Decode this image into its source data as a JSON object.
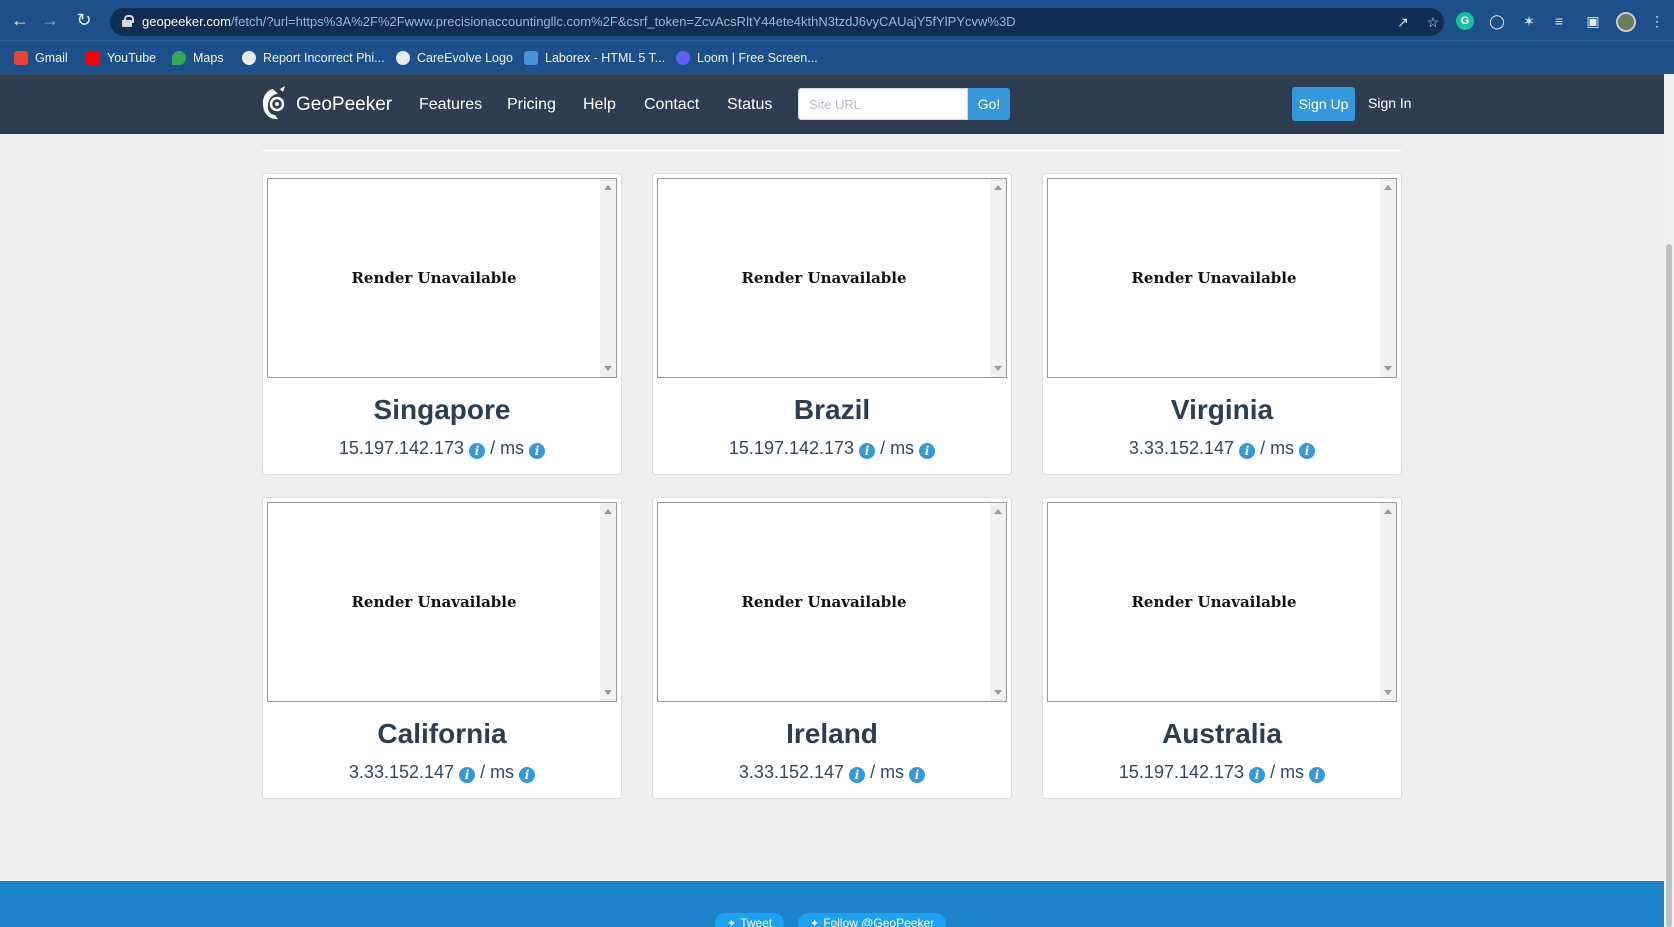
{
  "browser": {
    "url_host": "geopeeker.com",
    "url_rest": "/fetch/?url=https%3A%2F%2Fwww.precisionaccountingllc.com%2F&csrf_token=ZcvAcsRltY44ete4kthN3tzdJ6vyCAUajY5fYlPYcvw%3D",
    "bookmarks": [
      {
        "label": "Gmail",
        "color": "#ea4335"
      },
      {
        "label": "YouTube",
        "color": "#ff0000"
      },
      {
        "label": "Maps",
        "color": "#34a853"
      },
      {
        "label": "Report Incorrect Phi...",
        "color": "#e8eaed"
      },
      {
        "label": "CareEvolve Logo",
        "color": "#e8eaed"
      },
      {
        "label": "Laborex - HTML 5 T...",
        "color": "#4a90d9"
      },
      {
        "label": "Loom | Free Screen...",
        "color": "#625df5"
      }
    ]
  },
  "nav": {
    "brand": "GeoPeeker",
    "links": [
      "Features",
      "Pricing",
      "Help",
      "Contact",
      "Status"
    ],
    "search_placeholder": "Site URL",
    "go_label": "Go!",
    "signup_label": "Sign Up",
    "signin_label": "Sign In"
  },
  "render_unavailable": "Render Unavailable",
  "locations": [
    {
      "name": "Singapore",
      "ip": "15.197.142.173",
      "ms": "/ ms"
    },
    {
      "name": "Brazil",
      "ip": "15.197.142.173",
      "ms": "/ ms"
    },
    {
      "name": "Virginia",
      "ip": "3.33.152.147",
      "ms": "/ ms"
    },
    {
      "name": "California",
      "ip": "3.33.152.147",
      "ms": "/ ms"
    },
    {
      "name": "Ireland",
      "ip": "3.33.152.147",
      "ms": "/ ms"
    },
    {
      "name": "Australia",
      "ip": "15.197.142.173",
      "ms": "/ ms"
    }
  ],
  "footer": {
    "tweet_label": "Tweet",
    "follow_label": "Follow @GeoPeeker"
  },
  "colors": {
    "nav_bg": "#2e3d4f",
    "accent": "#3498db",
    "footer_bg": "#1d82c9"
  }
}
